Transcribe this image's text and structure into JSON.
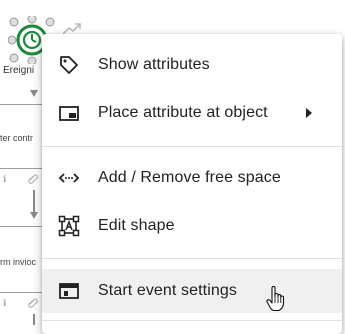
{
  "diagram": {
    "event_label": "Ereigni",
    "row1_text": "ter contr",
    "row2_text": "rm invioc",
    "icon_info": "ℹ",
    "icon_attach": "📎"
  },
  "menu": {
    "items": [
      {
        "label": "Show attributes",
        "icon": "tag-icon"
      },
      {
        "label": "Place attribute at object",
        "icon": "place-attribute-icon",
        "has_submenu": true
      },
      {
        "label": "Add / Remove free space",
        "icon": "free-space-icon"
      },
      {
        "label": "Edit shape",
        "icon": "edit-shape-icon"
      },
      {
        "label": "Start event settings",
        "icon": "start-event-settings-icon",
        "hovered": true
      }
    ]
  },
  "colors": {
    "event_green": "#1b8a3a",
    "menu_hover": "#f0f0f0",
    "text": "#222222"
  }
}
